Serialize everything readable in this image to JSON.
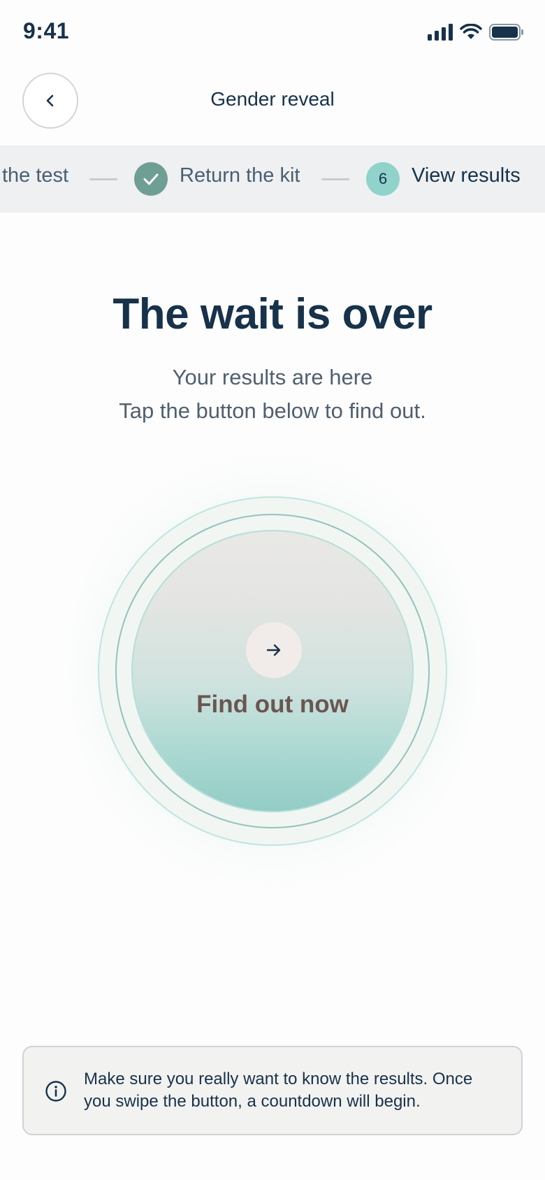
{
  "status_bar": {
    "time": "9:41",
    "icons": [
      "signal-icon",
      "wifi-icon",
      "battery-icon"
    ]
  },
  "header": {
    "back_icon": "chevron-left-icon",
    "title": "Gender reveal"
  },
  "stepper": {
    "steps": [
      {
        "label": "the test",
        "state": "partial"
      },
      {
        "label": "Return the kit",
        "state": "complete",
        "icon": "check-icon"
      },
      {
        "label": "View results",
        "state": "active",
        "number": "6"
      }
    ]
  },
  "main": {
    "headline": "The wait is over",
    "subtext_line1": "Your results are here",
    "subtext_line2": "Tap the button below to find out.",
    "button_label": "Find out now",
    "button_icon": "arrow-right-icon"
  },
  "info": {
    "icon": "info-icon",
    "line1": "Make sure you really want to know the results. Once",
    "line2": "you swipe the button, a countdown will begin."
  },
  "colors": {
    "text_primary": "#17324a",
    "accent_teal": "#8fd3cb",
    "complete_teal": "#6f9e95",
    "button_label": "#6b5552"
  }
}
